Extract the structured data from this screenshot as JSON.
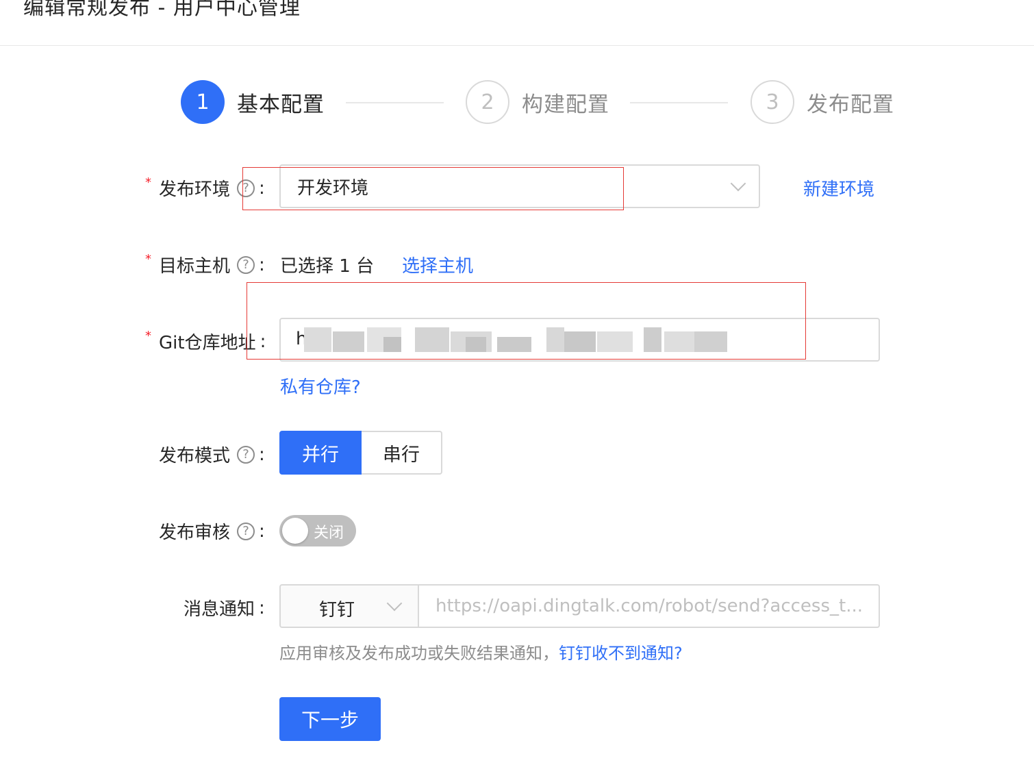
{
  "page": {
    "title": "编辑常规发布 - 用户中心管理"
  },
  "steps": [
    {
      "number": "1",
      "label": "基本配置",
      "state": "active"
    },
    {
      "number": "2",
      "label": "构建配置",
      "state": "wait"
    },
    {
      "number": "3",
      "label": "发布配置",
      "state": "wait"
    }
  ],
  "form": {
    "env": {
      "label": "发布环境",
      "required_mark": "*",
      "help": "?",
      "colon": ":",
      "value": "开发环境",
      "new_link": "新建环境"
    },
    "host": {
      "label": "目标主机",
      "required_mark": "*",
      "help": "?",
      "colon": ":",
      "selected_text": "已选择 1 台",
      "select_link": "选择主机"
    },
    "git": {
      "label": "Git仓库地址",
      "required_mark": "*",
      "colon": ":",
      "value_prefix": "h",
      "private_link": "私有仓库?"
    },
    "mode": {
      "label": "发布模式",
      "help": "?",
      "colon": ":",
      "options": [
        "并行",
        "串行"
      ],
      "selected": "并行"
    },
    "review": {
      "label": "发布审核",
      "help": "?",
      "colon": ":",
      "switch_text": "关闭",
      "enabled": false
    },
    "notify": {
      "label": "消息通知",
      "colon": ":",
      "channel": "钉钉",
      "url_placeholder": "https://oapi.dingtalk.com/robot/send?access_t...",
      "hint": "应用审核及发布成功或失败结果通知，",
      "hint_link": "钉钉收不到通知?"
    }
  },
  "actions": {
    "next_label": "下一步"
  },
  "colors": {
    "primary": "#2f6ff7",
    "required": "#f5222d",
    "highlight_box": "#e53935"
  }
}
